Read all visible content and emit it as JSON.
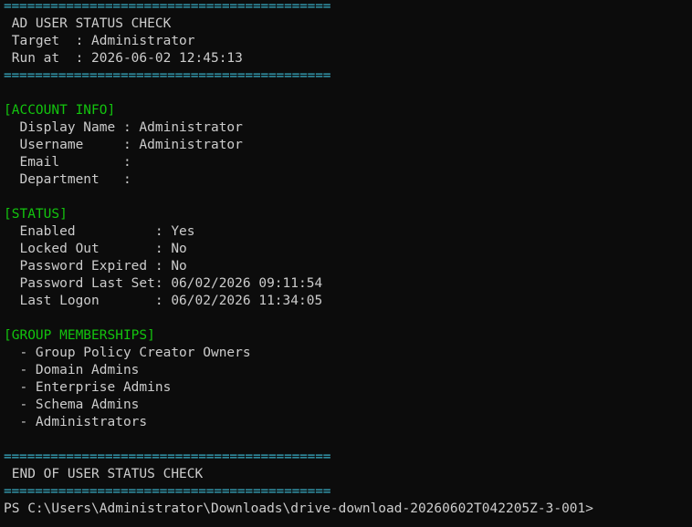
{
  "terminal": {
    "separator": "==========================================",
    "banner": {
      "title": " AD USER STATUS CHECK",
      "target": " Target  : Administrator",
      "run_at": " Run at  : 2026-06-02 12:45:13"
    },
    "account_info": {
      "header": "[ACCOUNT INFO]",
      "lines": [
        "  Display Name : Administrator",
        "  Username     : Administrator",
        "  Email        :",
        "  Department   :"
      ]
    },
    "status": {
      "header": "[STATUS]",
      "lines": [
        "  Enabled          : Yes",
        "  Locked Out       : No",
        "  Password Expired : No",
        "  Password Last Set: 06/02/2026 09:11:54",
        "  Last Logon       : 06/02/2026 11:34:05"
      ]
    },
    "groups": {
      "header": "[GROUP MEMBERSHIPS]",
      "items": [
        "  - Group Policy Creator Owners",
        "  - Domain Admins",
        "  - Enterprise Admins",
        "  - Schema Admins",
        "  - Administrators"
      ]
    },
    "footer": {
      "title": " END OF USER STATUS CHECK"
    },
    "prompt": "PS C:\\Users\\Administrator\\Downloads\\drive-download-20260602T042205Z-3-001>"
  },
  "colors": {
    "background": "#0c0c0c",
    "text": "#cccccc",
    "separator": "#3ab0c8",
    "section_header": "#13c40e"
  }
}
